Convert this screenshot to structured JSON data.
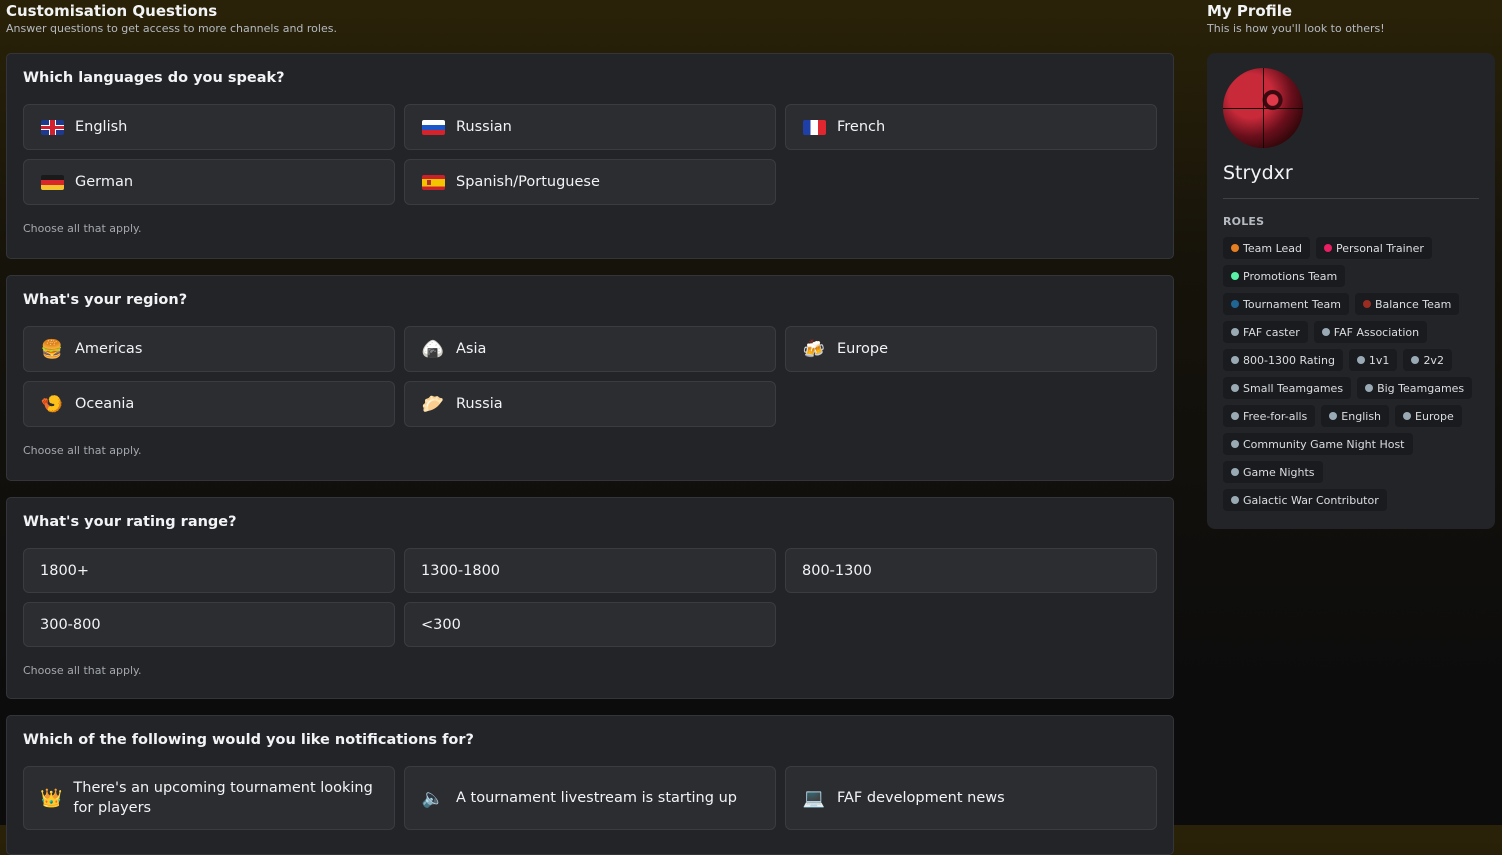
{
  "left_header": {
    "title": "Customisation Questions",
    "subtitle": "Answer questions to get access to more channels and roles."
  },
  "right_header": {
    "title": "My Profile",
    "subtitle": "This is how you'll look to others!"
  },
  "questions": [
    {
      "question": "Which languages do you speak?",
      "hint": "Choose all that apply.",
      "options": [
        {
          "label": "English",
          "icon": "uk-flag-icon"
        },
        {
          "label": "Russian",
          "icon": "russia-flag-icon"
        },
        {
          "label": "French",
          "icon": "france-flag-icon"
        },
        {
          "label": "German",
          "icon": "germany-flag-icon"
        },
        {
          "label": "Spanish/Portuguese",
          "icon": "spain-flag-icon"
        }
      ]
    },
    {
      "question": "What's your region?",
      "hint": "Choose all that apply.",
      "options": [
        {
          "label": "Americas",
          "icon": "hamburger-icon",
          "glyph": "🍔"
        },
        {
          "label": "Asia",
          "icon": "rice-ball-icon",
          "glyph": "🍙"
        },
        {
          "label": "Europe",
          "icon": "beer-mugs-icon",
          "glyph": "🍻"
        },
        {
          "label": "Oceania",
          "icon": "shrimp-icon",
          "glyph": "🍤"
        },
        {
          "label": "Russia",
          "icon": "dumpling-icon",
          "glyph": "🥟"
        }
      ]
    },
    {
      "question": "What's your rating range?",
      "hint": "Choose all that apply.",
      "options": [
        {
          "label": "1800+"
        },
        {
          "label": "1300-1800"
        },
        {
          "label": "800-1300"
        },
        {
          "label": "300-800"
        },
        {
          "label": "<300"
        }
      ]
    },
    {
      "question": "Which of the following would you like notifications for?",
      "options": [
        {
          "label": "There's an upcoming tournament looking for players",
          "icon": "crown-icon",
          "glyph": "👑"
        },
        {
          "label": "A tournament livestream is starting up",
          "icon": "speaker-icon",
          "glyph": "🔈"
        },
        {
          "label": "FAF development news",
          "icon": "laptop-icon",
          "glyph": "💻"
        }
      ]
    }
  ],
  "profile": {
    "username": "Strydxr",
    "roles_heading": "ROLES",
    "roles": [
      {
        "name": "Team Lead",
        "color": "#e67e22"
      },
      {
        "name": "Personal Trainer",
        "color": "#e91e63"
      },
      {
        "name": "Promotions Team",
        "color": "#57f2a8"
      },
      {
        "name": "Tournament Team",
        "color": "#206694"
      },
      {
        "name": "Balance Team",
        "color": "#992d22"
      },
      {
        "name": "FAF caster",
        "color": "#99aab5"
      },
      {
        "name": "FAF Association",
        "color": "#99aab5"
      },
      {
        "name": "800-1300 Rating",
        "color": "#99aab5"
      },
      {
        "name": "1v1",
        "color": "#99aab5"
      },
      {
        "name": "2v2",
        "color": "#99aab5"
      },
      {
        "name": "Small Teamgames",
        "color": "#99aab5"
      },
      {
        "name": "Big Teamgames",
        "color": "#99aab5"
      },
      {
        "name": "Free-for-alls",
        "color": "#99aab5"
      },
      {
        "name": "English",
        "color": "#99aab5"
      },
      {
        "name": "Europe",
        "color": "#99aab5"
      },
      {
        "name": "Community Game Night Host",
        "color": "#99aab5"
      },
      {
        "name": "Game Nights",
        "color": "#99aab5"
      },
      {
        "name": "Galactic War Contributor",
        "color": "#99aab5"
      }
    ]
  }
}
